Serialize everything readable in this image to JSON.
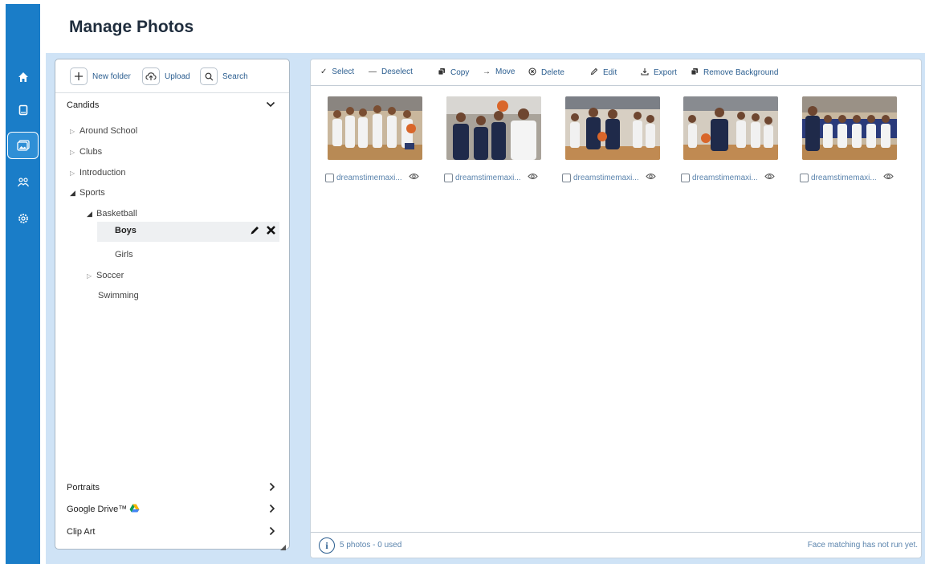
{
  "page": {
    "title": "Manage Photos"
  },
  "nav": [
    {
      "icon": "home-icon",
      "active": false
    },
    {
      "icon": "book-icon",
      "active": false
    },
    {
      "icon": "photos-icon",
      "active": true
    },
    {
      "icon": "people-icon",
      "active": false
    },
    {
      "icon": "settings-icon",
      "active": false
    }
  ],
  "tree_toolbar": {
    "new_folder": "New folder",
    "upload": "Upload",
    "search": "Search"
  },
  "tree": {
    "candids_label": "Candids",
    "around_school": "Around School",
    "clubs": "Clubs",
    "introduction": "Introduction",
    "sports": "Sports",
    "basketball": "Basketball",
    "boys": "Boys",
    "girls": "Girls",
    "soccer": "Soccer",
    "swimming": "Swimming",
    "portraits": "Portraits",
    "google_drive": "Google Drive™",
    "clip_art": "Clip Art"
  },
  "actions": {
    "select": "Select",
    "deselect": "Deselect",
    "copy": "Copy",
    "move": "Move",
    "delete": "Delete",
    "edit": "Edit",
    "export": "Export",
    "remove_background": "Remove Background"
  },
  "photos": [
    {
      "name": "dreamstimemaxi..."
    },
    {
      "name": "dreamstimemaxi..."
    },
    {
      "name": "dreamstimemaxi..."
    },
    {
      "name": "dreamstimemaxi..."
    },
    {
      "name": "dreamstimemaxi..."
    }
  ],
  "status": {
    "count": "5 photos - 0 used",
    "face_matching": "Face matching has not run yet."
  },
  "colors": {
    "sidebar": "#1a7dc8",
    "workspace": "#cfe3f6",
    "link": "#2a5d8f",
    "muted_link": "#5b84ad"
  }
}
